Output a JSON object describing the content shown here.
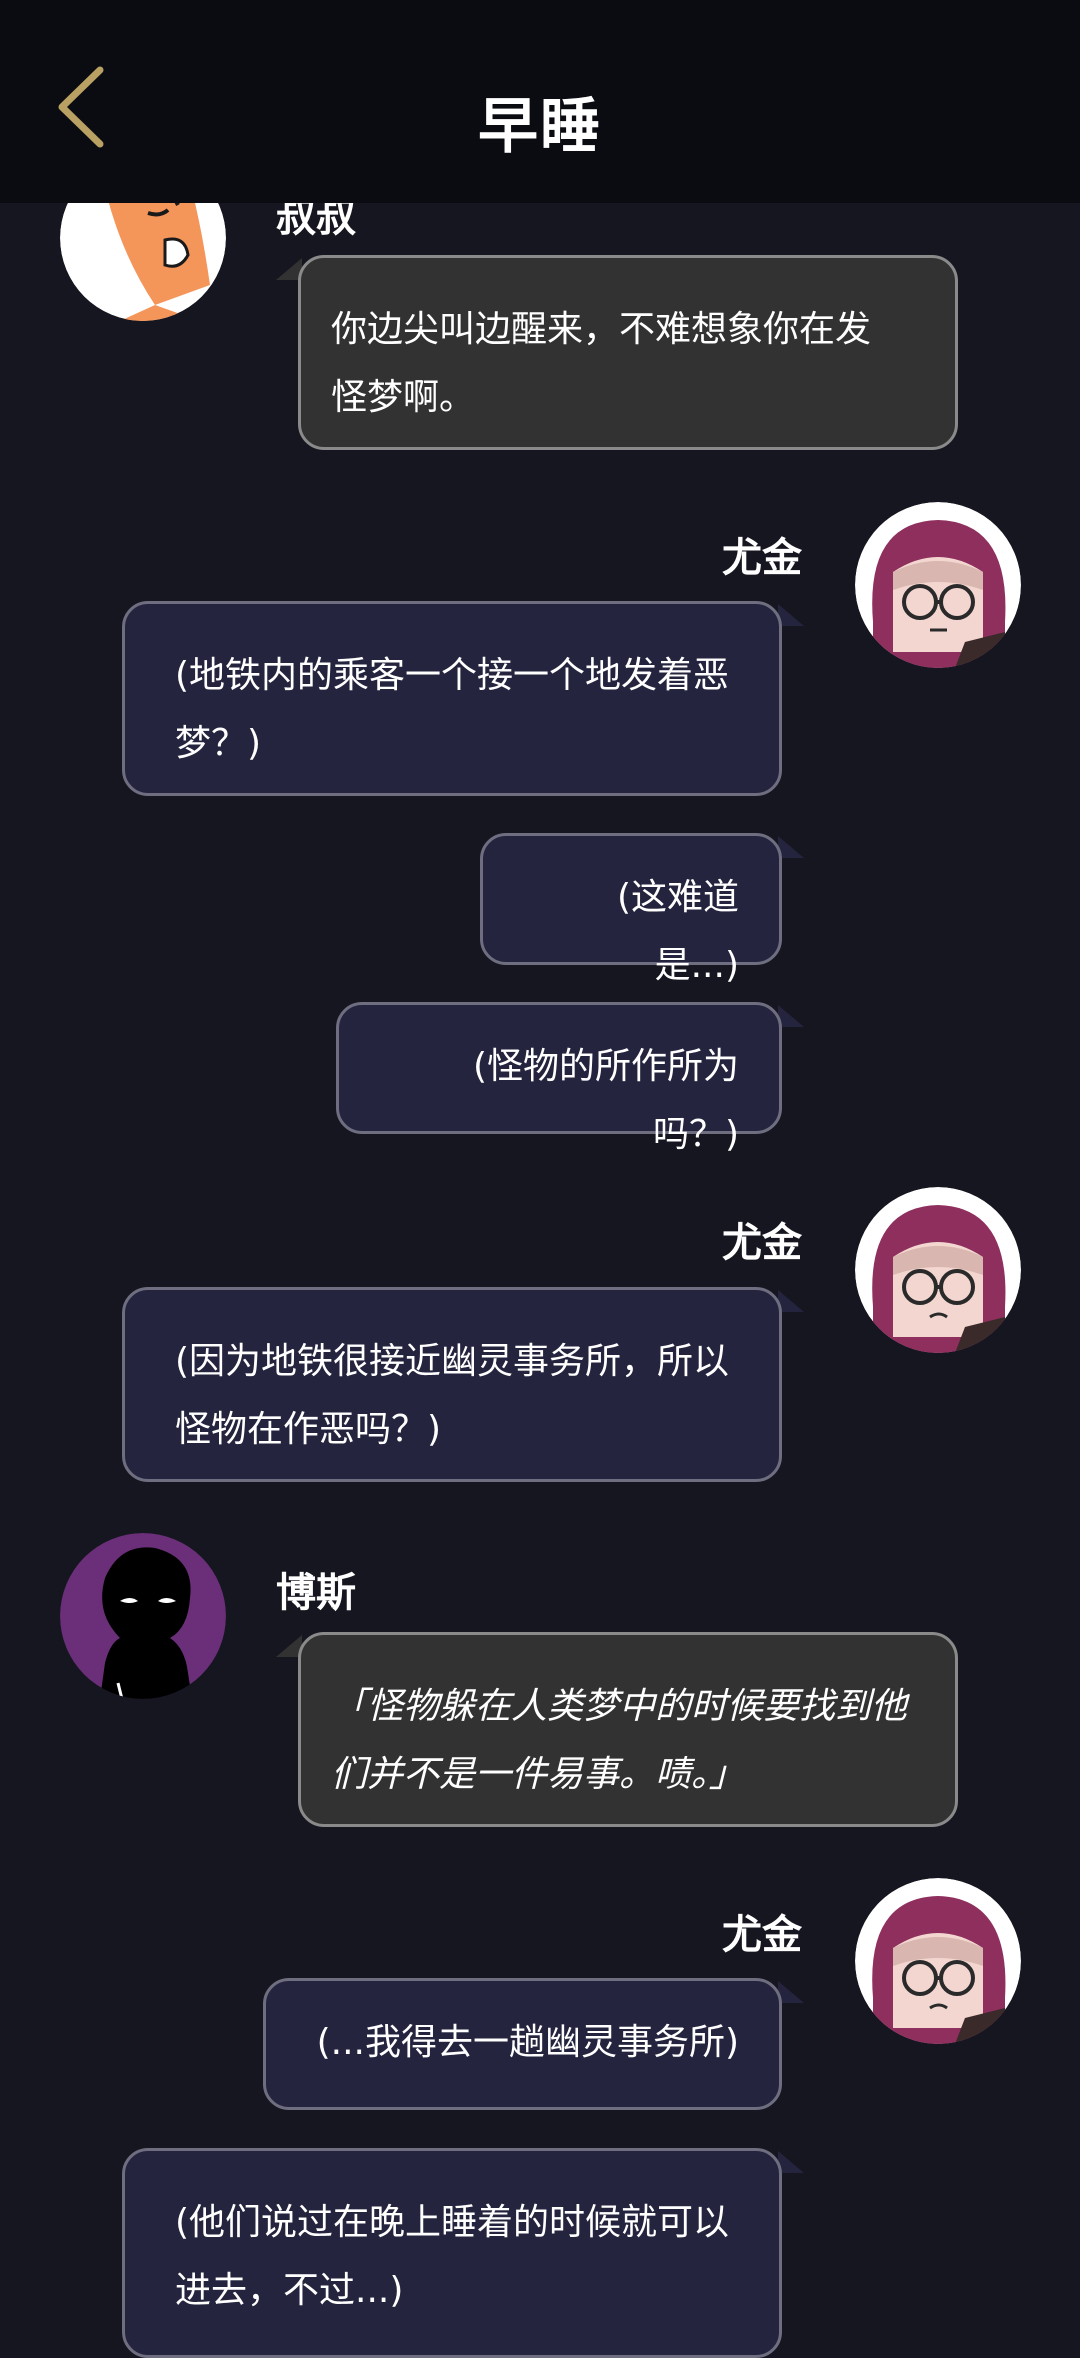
{
  "header": {
    "title": "早睡"
  },
  "messages": [
    {
      "speaker": "叔叔",
      "text_lines": [
        "你边尖叫边醒来，不难想象你在发",
        "怪梦啊。"
      ]
    },
    {
      "speaker": "尤金",
      "text_lines": [
        "(地铁内的乘客一个接一个地发着恶",
        "梦？)"
      ]
    },
    {
      "text_lines": [
        "(这难道是...)"
      ]
    },
    {
      "text_lines": [
        "(怪物的所作所为吗？)"
      ]
    },
    {
      "speaker": "尤金",
      "text_lines": [
        "(因为地铁很接近幽灵事务所，所以",
        "怪物在作恶吗？)"
      ]
    },
    {
      "speaker": "博斯",
      "text_lines": [
        "「怪物躲在人类梦中的时候要找到他",
        "们并不是一件易事。啧。」"
      ]
    },
    {
      "speaker": "尤金",
      "text_lines": [
        "(...我得去一趟幽灵事务所)"
      ]
    },
    {
      "text_lines": [
        "(他们说过在晚上睡着的时候就可以",
        "进去，不过...)"
      ]
    }
  ],
  "colors": {
    "background": "#161620",
    "header": "#0b0c12",
    "back_arrow": "#b9a063",
    "npc_bubble": "#323232",
    "player_bubble": "#24243e",
    "boss_avatar_bg": "#6a2f78",
    "eugene_hood": "#8f2f5e"
  }
}
